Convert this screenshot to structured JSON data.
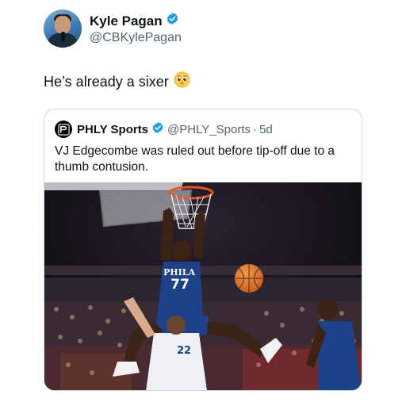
{
  "post": {
    "author": {
      "display_name": "Kyle Pagan",
      "handle": "@CBKylePagan",
      "verified": true
    },
    "text": "He’s already a sixer",
    "emoji": "pleading-face"
  },
  "quote": {
    "author": {
      "display_name": "PHLY Sports",
      "handle": "@PHLY_Sports",
      "verified": true
    },
    "separator": "·",
    "timestamp": "5d",
    "text": "VJ Edgecombe was ruled out before tip-off due to a thumb contusion.",
    "media": {
      "jersey_front": {
        "team": "PHILA",
        "number": "77"
      },
      "jersey_back": {
        "number": "22"
      }
    }
  },
  "colors": {
    "verified": "#1d9bf0",
    "secondary_text": "#536471",
    "card_border": "#cfd9de",
    "sixers_blue": "#1d428a",
    "ball": "#e0722a"
  }
}
